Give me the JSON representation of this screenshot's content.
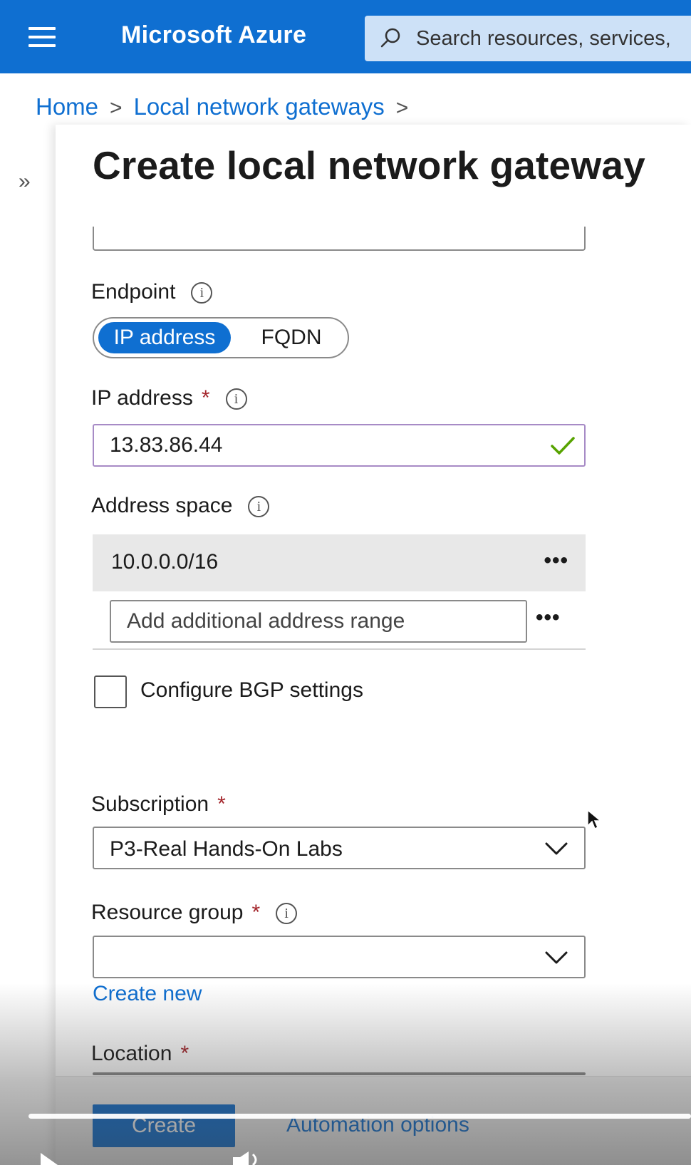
{
  "header": {
    "brand": "Microsoft Azure",
    "search_placeholder": "Search resources, services,"
  },
  "breadcrumb": {
    "items": [
      "Home",
      "Local network gateways"
    ]
  },
  "page": {
    "title": "Create local network gateway"
  },
  "form": {
    "endpoint": {
      "label": "Endpoint",
      "options": [
        "IP address",
        "FQDN"
      ],
      "selected": "IP address"
    },
    "ip_address": {
      "label": "IP address",
      "required_mark": "*",
      "value": "13.83.86.44"
    },
    "address_space": {
      "label": "Address space",
      "rows": [
        "10.0.0.0/16"
      ],
      "add_placeholder": "Add additional address range",
      "more_label": "•••"
    },
    "bgp": {
      "label": "Configure BGP settings",
      "checked": false
    },
    "subscription": {
      "label": "Subscription",
      "required_mark": "*",
      "value": "P3-Real Hands-On Labs"
    },
    "resource_group": {
      "label": "Resource group",
      "required_mark": "*",
      "value": "",
      "create_new": "Create new"
    },
    "location": {
      "label": "Location",
      "required_mark": "*"
    }
  },
  "footer": {
    "create_label": "Create",
    "automation_label": "Automation options"
  },
  "colors": {
    "azure_blue": "#0f6fd1",
    "required_red": "#a4262c",
    "valid_green": "#57a300"
  }
}
